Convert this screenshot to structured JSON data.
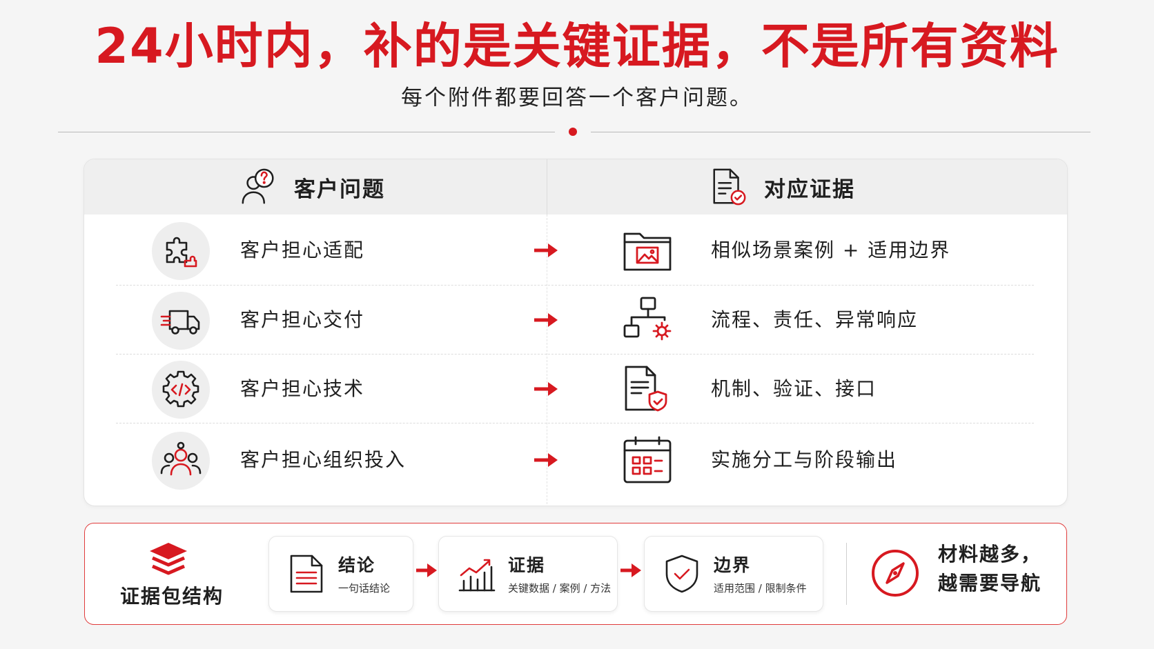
{
  "header": {
    "title": "24小时内，补的是关键证据，不是所有资料",
    "subtitle": "每个附件都要回答一个客户问题。"
  },
  "table": {
    "left_header": "客户问题",
    "right_header": "对应证据",
    "left_header_icon": "question-bubble-person-icon",
    "right_header_icon": "document-check-icon",
    "rows": [
      {
        "question": "客户担心适配",
        "question_icon": "puzzle-icon",
        "evidence": "相似场景案例 + 适用边界",
        "evidence_icon": "folder-image-icon"
      },
      {
        "question": "客户担心交付",
        "question_icon": "delivery-truck-icon",
        "evidence": "流程、责任、异常响应",
        "evidence_icon": "flowchart-gear-icon"
      },
      {
        "question": "客户担心技术",
        "question_icon": "code-gear-icon",
        "evidence": "机制、验证、接口",
        "evidence_icon": "document-shield-icon"
      },
      {
        "question": "客户担心组织投入",
        "question_icon": "team-icon",
        "evidence": "实施分工与阶段输出",
        "evidence_icon": "calendar-icon"
      }
    ]
  },
  "bottom": {
    "package_label": "证据包结构",
    "package_icon": "layers-icon",
    "steps": [
      {
        "title": "结论",
        "subtitle": "一句话结论",
        "icon": "document-lines-icon"
      },
      {
        "title": "证据",
        "subtitle": "关键数据 / 案例 / 方法",
        "icon": "bar-chart-icon"
      },
      {
        "title": "边界",
        "subtitle": "适用范围 / 限制条件",
        "icon": "shield-check-icon"
      }
    ],
    "closing_line1": "材料越多，",
    "closing_line2": "越需要导航",
    "closing_icon": "compass-icon"
  },
  "colors": {
    "accent": "#d71920",
    "background": "#f5f5f5",
    "header_row": "#efefef"
  }
}
